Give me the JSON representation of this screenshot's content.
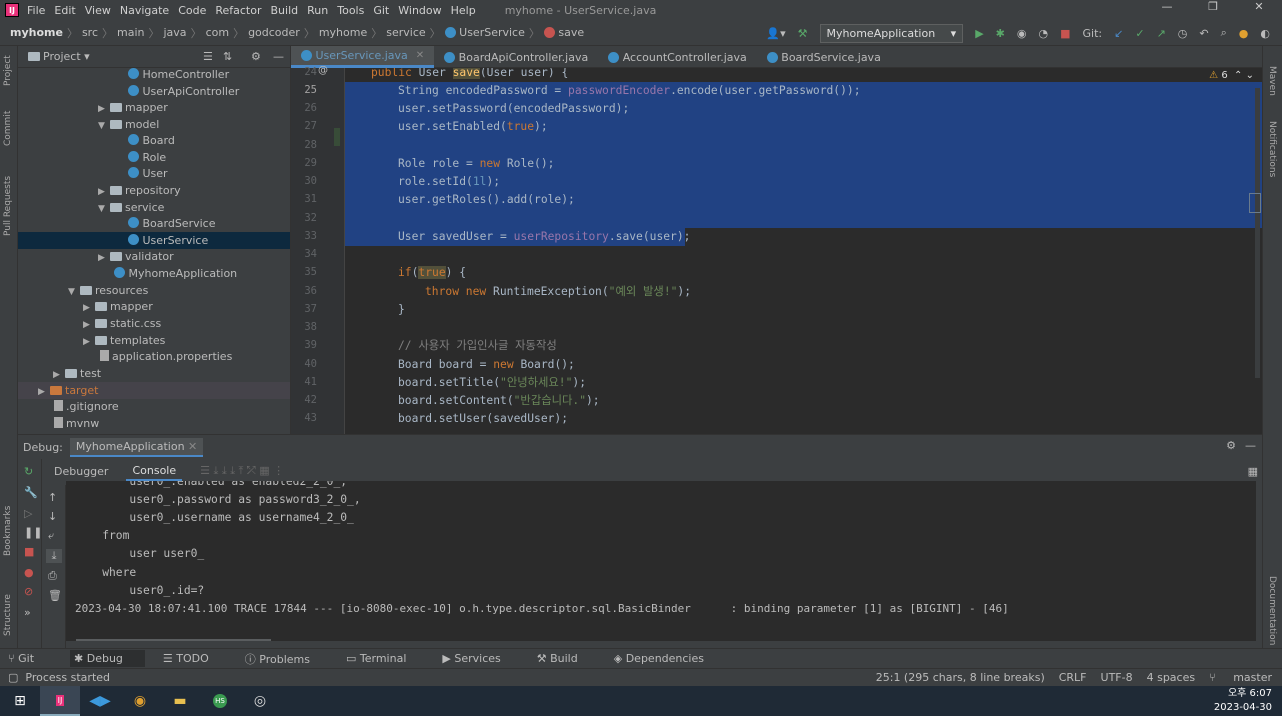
{
  "titlebar": {
    "menu": [
      "File",
      "Edit",
      "View",
      "Navigate",
      "Code",
      "Refactor",
      "Build",
      "Run",
      "Tools",
      "Git",
      "Window",
      "Help"
    ],
    "title": "myhome - UserService.java"
  },
  "navbar": {
    "breadcrumbs": [
      "myhome",
      "src",
      "main",
      "java",
      "com",
      "godcoder",
      "myhome",
      "service",
      "UserService",
      "save"
    ],
    "run_config": "MyhomeApplication",
    "git_label": "Git:"
  },
  "left_strip": {
    "project": "Project",
    "commit": "Commit",
    "pull": "Pull Requests",
    "bookmarks": "Bookmarks",
    "structure": "Structure"
  },
  "right_strip": {
    "maven": "Maven",
    "notifications": "Notifications",
    "documentation": "Documentation"
  },
  "project": {
    "title": "Project",
    "tree": [
      {
        "label": "HomeController",
        "type": "class"
      },
      {
        "label": "UserApiController",
        "type": "class"
      },
      {
        "label": "mapper",
        "type": "folder"
      },
      {
        "label": "model",
        "type": "folder"
      },
      {
        "label": "Board",
        "type": "class"
      },
      {
        "label": "Role",
        "type": "class"
      },
      {
        "label": "User",
        "type": "class"
      },
      {
        "label": "repository",
        "type": "folder"
      },
      {
        "label": "service",
        "type": "folder"
      },
      {
        "label": "BoardService",
        "type": "class"
      },
      {
        "label": "UserService",
        "type": "class"
      },
      {
        "label": "validator",
        "type": "folder"
      },
      {
        "label": "MyhomeApplication",
        "type": "class"
      },
      {
        "label": "resources",
        "type": "folder"
      },
      {
        "label": "mapper",
        "type": "folder"
      },
      {
        "label": "static.css",
        "type": "folder"
      },
      {
        "label": "templates",
        "type": "folder"
      },
      {
        "label": "application.properties",
        "type": "file"
      },
      {
        "label": "test",
        "type": "folder"
      },
      {
        "label": "target",
        "type": "folder"
      },
      {
        "label": ".gitignore",
        "type": "file"
      },
      {
        "label": "mvnw",
        "type": "file"
      }
    ]
  },
  "tabs": [
    {
      "label": "UserService.java"
    },
    {
      "label": "BoardApiController.java"
    },
    {
      "label": "AccountController.java"
    },
    {
      "label": "BoardService.java"
    }
  ],
  "editor": {
    "warnings": "6",
    "line_numbers": [
      "24",
      "25",
      "26",
      "27",
      "28",
      "29",
      "30",
      "31",
      "32",
      "33",
      "34",
      "35",
      "36",
      "37",
      "38",
      "39",
      "40",
      "41",
      "42",
      "43"
    ],
    "l24a": "public ",
    "l24b": "User ",
    "l24c": "save",
    "l24d": "(User user) {",
    "l25a": "String encodedPassword = ",
    "l25b": "passwordEncoder",
    ".l25c": "",
    "l25c": ".encode(user.getPassword());",
    "l26a": "user.setPassword(encodedPassword);",
    "l27a": "user.setEnabled(",
    "l27b": "true",
    "l27c": ");",
    "l29a": "Role role = ",
    "l29b": "new ",
    "l29c": "Role();",
    "l30a": "role.setId(",
    "l30b": "1l",
    "l30c": ");",
    "l31a": "user.getRoles().add(role);",
    "l33a": "User savedUser = ",
    "l33b": "userRepository",
    "l33c": ".save(user);",
    "l35a": "if",
    "l35b": "(",
    "l35c": "true",
    "l35d": ") {",
    "l36a": "throw new ",
    "l36b": "RuntimeException(",
    "l36c": "\"예외 발생!\"",
    "l36d": ");",
    "l37a": "}",
    "l39a": "// 사용자 가입인사글 자동작성",
    "l40a": "Board board = ",
    "l40b": "new ",
    "l40c": "Board();",
    "l41a": "board.setTitle(",
    "l41b": "\"안녕하세요!\"",
    "l41c": ");",
    "l42a": "board.setContent(",
    "l42b": "\"반갑습니다.\"",
    "l42c": ");",
    "l43a": "board.setUser(savedUser);"
  },
  "debug": {
    "label": "Debug:",
    "session": "MyhomeApplication",
    "tabs": [
      "Debugger",
      "Console"
    ],
    "console": [
      "        user0_.enabled as enabled2_2_0_,",
      "        user0_.password as password3_2_0_,",
      "        user0_.username as username4_2_0_",
      "    from",
      "        user user0_",
      "    where",
      "        user0_.id=?",
      "2023-04-30 18:07:41.100 TRACE 17844 --- [io-8080-exec-10] o.h.type.descriptor.sql.BasicBinder      : binding parameter [1] as [BIGINT] - [46]"
    ]
  },
  "bottom_tabs": [
    "Git",
    "Debug",
    "TODO",
    "Problems",
    "Terminal",
    "Services",
    "Build",
    "Dependencies"
  ],
  "status": {
    "left": "Process started",
    "position": "25:1 (295 chars, 8 line breaks)",
    "line_sep": "CRLF",
    "encoding": "UTF-8",
    "indent": "4 spaces",
    "branch": "master"
  },
  "taskbar": {
    "time": "오후 6:07",
    "date": "2023-04-30"
  }
}
